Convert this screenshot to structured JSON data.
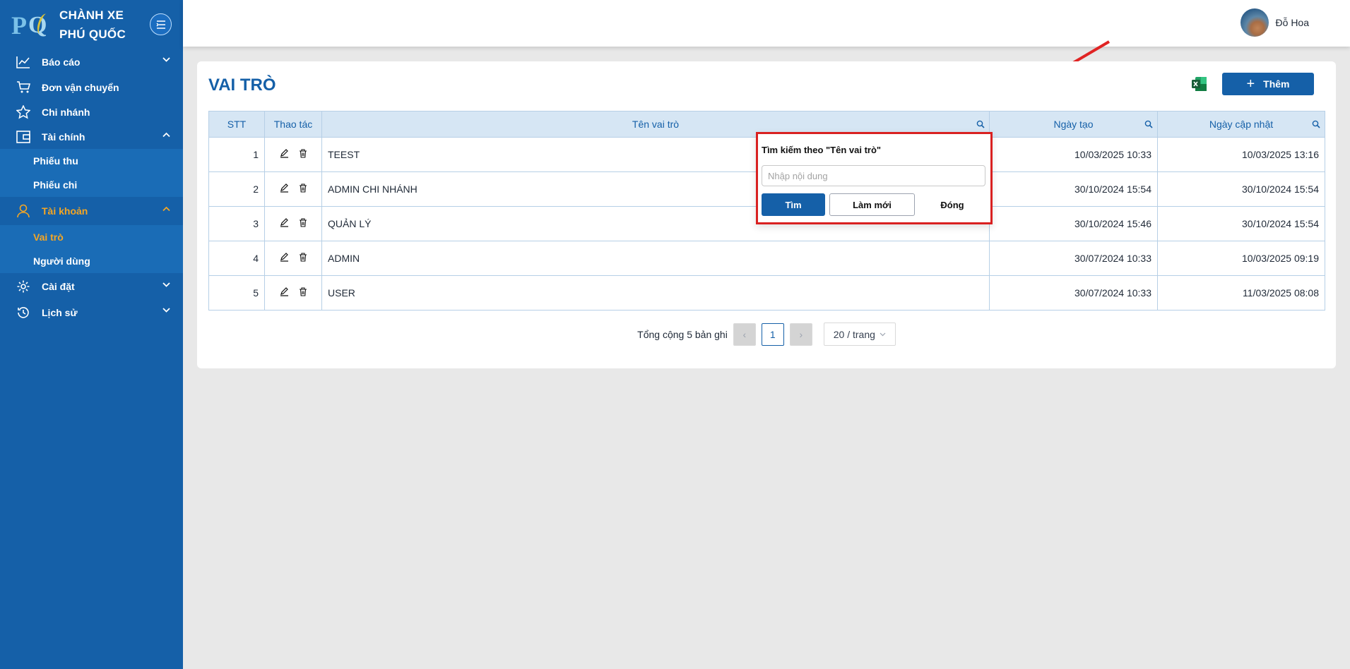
{
  "brand": {
    "name_line1": "CHÀNH XE",
    "name_line2": "PHÚ QUỐC"
  },
  "menu": {
    "items": [
      {
        "label": "Báo cáo",
        "icon": "line-chart-icon",
        "chevron": "down"
      },
      {
        "label": "Đơn vận chuyển",
        "icon": "cart-icon"
      },
      {
        "label": "Chi nhánh",
        "icon": "star-icon"
      },
      {
        "label": "Tài chính",
        "icon": "wallet-icon",
        "chevron": "up"
      },
      {
        "label": "Tài khoản",
        "icon": "user-icon",
        "chevron": "up",
        "active": true
      },
      {
        "label": "Cài đặt",
        "icon": "gear-icon",
        "chevron": "down"
      },
      {
        "label": "Lịch sử",
        "icon": "history-icon",
        "chevron": "down"
      }
    ],
    "finance_sub": [
      "Phiếu thu",
      "Phiếu chi"
    ],
    "account_sub": [
      "Vai trò",
      "Người dùng"
    ]
  },
  "header": {
    "user_name": "Đỗ Hoa"
  },
  "page": {
    "title": "VAI TRÒ",
    "add_label": "Thêm"
  },
  "table": {
    "headers": [
      "STT",
      "Thao tác",
      "Tên vai trò",
      "Ngày tạo",
      "Ngày cập nhật"
    ],
    "rows": [
      {
        "stt": "1",
        "name": "TEEST",
        "created": "10/03/2025 10:33",
        "updated": "10/03/2025 13:16"
      },
      {
        "stt": "2",
        "name": "ADMIN CHI NHÁNH",
        "created": "30/10/2024 15:54",
        "updated": "30/10/2024 15:54"
      },
      {
        "stt": "3",
        "name": "QUẢN LÝ",
        "created": "30/10/2024 15:46",
        "updated": "30/10/2024 15:54"
      },
      {
        "stt": "4",
        "name": "ADMIN",
        "created": "30/07/2024 10:33",
        "updated": "10/03/2025 09:19"
      },
      {
        "stt": "5",
        "name": "USER",
        "created": "30/07/2024 10:33",
        "updated": "11/03/2025 08:08"
      }
    ]
  },
  "pagination": {
    "total_text": "Tổng cộng 5 bản ghi",
    "current_page": "1",
    "page_size": "20 / trang",
    "prev": "‹",
    "next": "›"
  },
  "filter_popup": {
    "title": "Tìm kiếm theo \"Tên vai trò\"",
    "placeholder": "Nhập nội dung",
    "search_label": "Tìm",
    "reset_label": "Làm mới",
    "close_label": "Đóng"
  },
  "colors": {
    "primary": "#1560a8",
    "accent": "#f5a623",
    "highlight": "#d92121",
    "header_bg": "#d6e6f4"
  }
}
